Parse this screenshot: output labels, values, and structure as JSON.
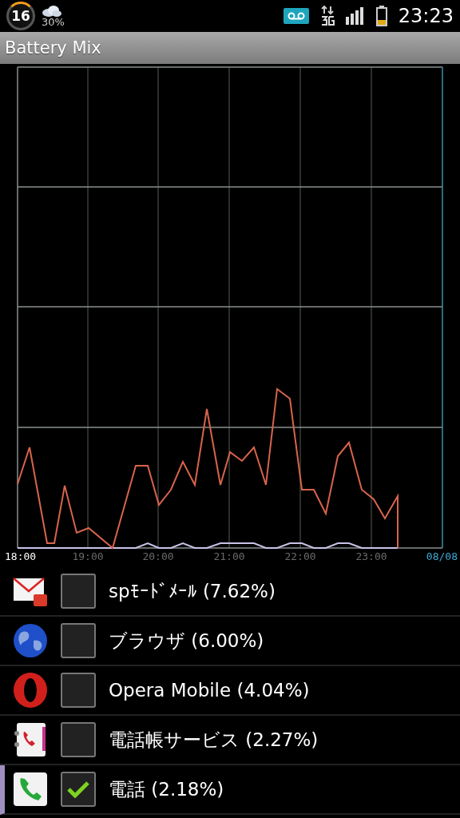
{
  "status_bar": {
    "badge": "16",
    "weather": "30%",
    "time": "23:23"
  },
  "title_bar": {
    "title": "Battery Mix"
  },
  "chart": {
    "axis_labels": [
      {
        "text": "18:00",
        "kind": "start"
      },
      {
        "text": "19:00",
        "kind": "hour"
      },
      {
        "text": "20:00",
        "kind": "hour"
      },
      {
        "text": "21:00",
        "kind": "hour"
      },
      {
        "text": "22:00",
        "kind": "hour"
      },
      {
        "text": "23:00",
        "kind": "hour"
      },
      {
        "text": "08/08",
        "kind": "date"
      }
    ]
  },
  "apps": [
    {
      "name": "spﾓｰﾄﾞﾒｰﾙ (7.62%)",
      "kind": "mail",
      "checked": false
    },
    {
      "name": "ブラウザ (6.00%)",
      "kind": "globe",
      "checked": false
    },
    {
      "name": "Opera Mobile (4.04%)",
      "kind": "opera",
      "checked": false
    },
    {
      "name": "電話帳サービス (2.27%)",
      "kind": "contacts",
      "checked": false
    },
    {
      "name": "電話 (2.18%)",
      "kind": "phone",
      "checked": true
    }
  ]
}
